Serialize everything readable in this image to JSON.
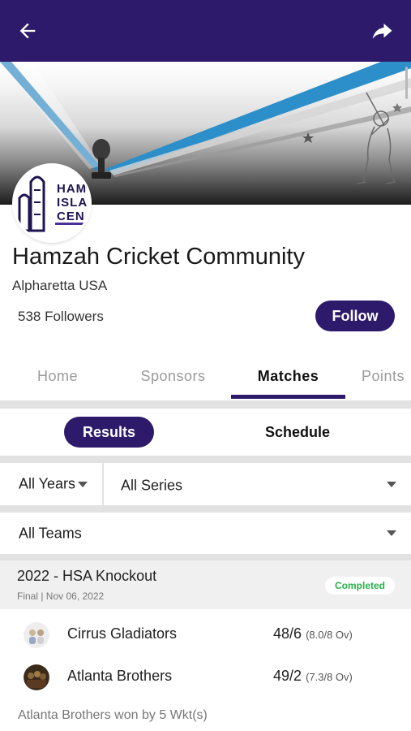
{
  "topbar": {
    "back_icon": "arrow-left-icon",
    "share_icon": "share-forward-icon",
    "color": "#2e1a6b"
  },
  "banner": {
    "logo_text": "HAM\nISLA\nCEN"
  },
  "profile": {
    "name": "Hamzah Cricket Community",
    "location": "Alpharetta USA",
    "followers": "538 Followers",
    "follow_label": "Follow"
  },
  "tabs": [
    {
      "label": "Home",
      "active": false
    },
    {
      "label": "Sponsors",
      "active": false
    },
    {
      "label": "Matches",
      "active": true
    },
    {
      "label": "Points",
      "active": false
    }
  ],
  "segments": {
    "results": "Results",
    "schedule": "Schedule",
    "selected": "Results"
  },
  "filters": {
    "years": "All Years",
    "series": "All Series",
    "teams": "All Teams"
  },
  "match": {
    "title": "2022 - HSA Knockout",
    "subtitle": "Final | Nov 06, 2022",
    "status": "Completed",
    "status_color": "#27b24a",
    "teams": [
      {
        "name": "Cirrus Gladiators",
        "score": "48/6",
        "overs": "(8.0/8 Ov)"
      },
      {
        "name": "Atlanta Brothers",
        "score": "49/2",
        "overs": "(7.3/8 Ov)"
      }
    ],
    "result": "Atlanta Brothers won by 5 Wkt(s)"
  }
}
